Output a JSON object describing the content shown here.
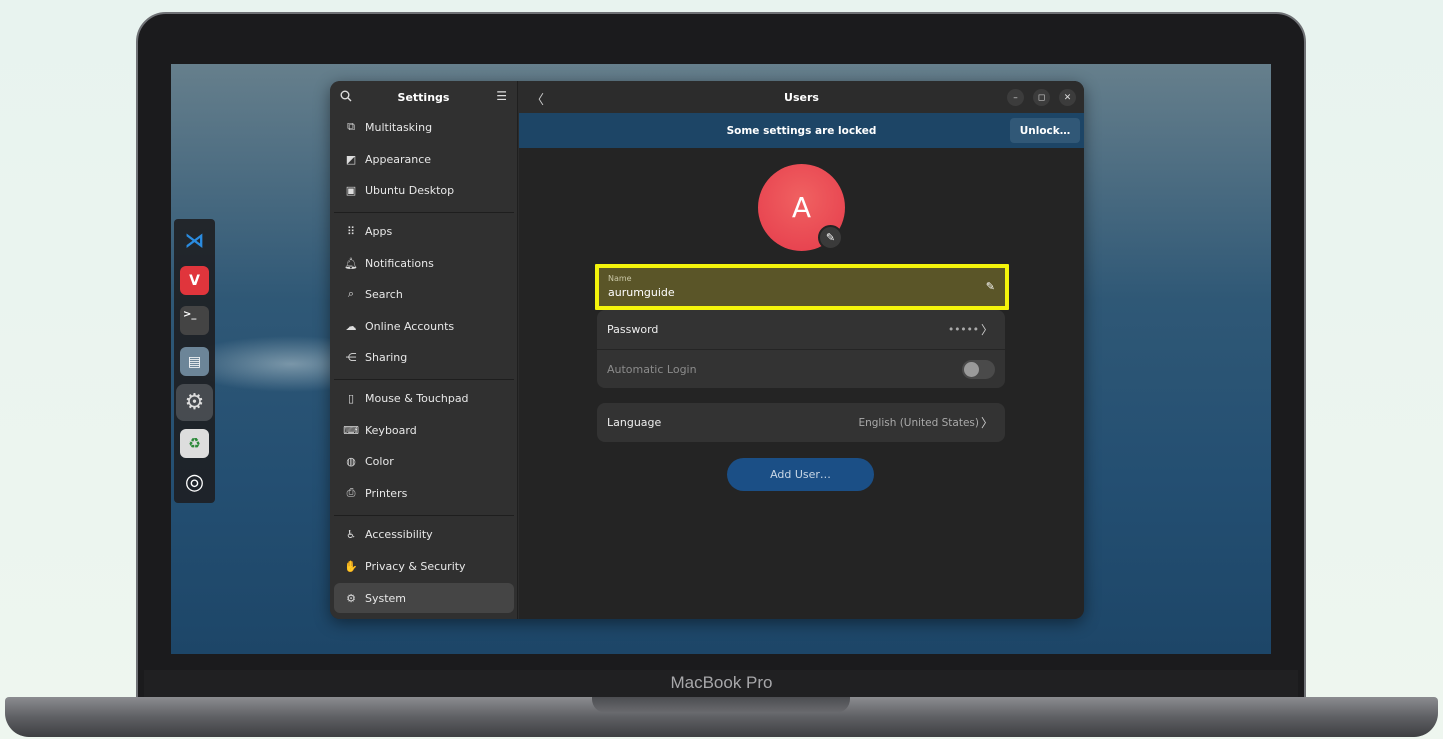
{
  "device": {
    "brand": "MacBook Pro"
  },
  "dock": {
    "items": [
      {
        "name": "vscode",
        "glyph": "⋊",
        "color": "#2a8ce0"
      },
      {
        "name": "vivaldi",
        "glyph": "V",
        "color": "#e0353c"
      },
      {
        "name": "terminal",
        "glyph": ">_",
        "color": "#444444"
      },
      {
        "name": "files",
        "glyph": "▤",
        "color": "#6c8598"
      },
      {
        "name": "settings",
        "glyph": "⚙",
        "color": "#5f5f5f"
      },
      {
        "name": "trash",
        "glyph": "♻",
        "color": "#6e8a6e"
      },
      {
        "name": "ubuntu",
        "glyph": "◎",
        "color": "#222222"
      }
    ]
  },
  "sidebar": {
    "title": "Settings",
    "items": [
      {
        "label": "Multitasking",
        "icon": "multitasking-icon",
        "glyph": "⧉"
      },
      {
        "label": "Appearance",
        "icon": "appearance-icon",
        "glyph": "◩"
      },
      {
        "label": "Ubuntu Desktop",
        "icon": "desktop-icon",
        "glyph": "▣"
      },
      {
        "label": "Apps",
        "icon": "apps-icon",
        "glyph": "⠿"
      },
      {
        "label": "Notifications",
        "icon": "bell-icon",
        "glyph": "🔔︎"
      },
      {
        "label": "Search",
        "icon": "search-icon",
        "glyph": "⌕"
      },
      {
        "label": "Online Accounts",
        "icon": "cloud-icon",
        "glyph": "☁"
      },
      {
        "label": "Sharing",
        "icon": "share-icon",
        "glyph": "⋲"
      },
      {
        "label": "Mouse & Touchpad",
        "icon": "mouse-icon",
        "glyph": "▯"
      },
      {
        "label": "Keyboard",
        "icon": "keyboard-icon",
        "glyph": "⌨"
      },
      {
        "label": "Color",
        "icon": "color-icon",
        "glyph": "◍"
      },
      {
        "label": "Printers",
        "icon": "printer-icon",
        "glyph": "⎙"
      },
      {
        "label": "Accessibility",
        "icon": "accessibility-icon",
        "glyph": "♿"
      },
      {
        "label": "Privacy & Security",
        "icon": "hand-icon",
        "glyph": "✋"
      },
      {
        "label": "System",
        "icon": "system-icon",
        "glyph": "⚙"
      }
    ],
    "selected": "System"
  },
  "main": {
    "title": "Users",
    "banner": {
      "text": "Some settings are locked",
      "button": "Unlock…"
    },
    "avatar": {
      "initial": "A",
      "color": "#e84150"
    },
    "name_field": {
      "label": "Name",
      "value": "aurumguide"
    },
    "password": {
      "label": "Password",
      "value": "•••••"
    },
    "auto_login": {
      "label": "Automatic Login",
      "enabled": false
    },
    "language": {
      "label": "Language",
      "value": "English (United States)"
    },
    "add_user": "Add User…"
  },
  "colors": {
    "highlight_border": "#f4f40b",
    "banner_bg": "#1d4566",
    "accent": "#1b4f86"
  }
}
